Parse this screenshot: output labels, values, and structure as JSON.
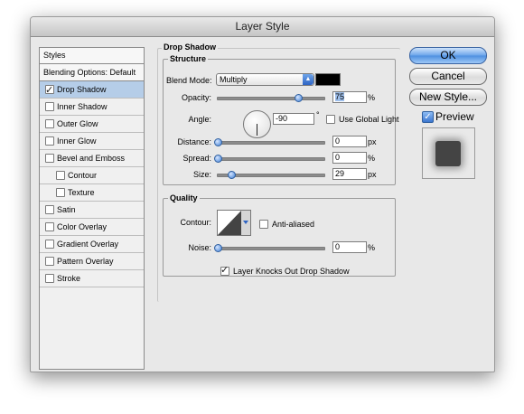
{
  "window": {
    "title": "Layer Style"
  },
  "styles_list": {
    "header": "Styles",
    "blending_options": "Blending Options: Default",
    "items": [
      {
        "label": "Drop Shadow",
        "checked": true,
        "selected": true,
        "indent": false
      },
      {
        "label": "Inner Shadow",
        "checked": false,
        "selected": false,
        "indent": false
      },
      {
        "label": "Outer Glow",
        "checked": false,
        "selected": false,
        "indent": false
      },
      {
        "label": "Inner Glow",
        "checked": false,
        "selected": false,
        "indent": false
      },
      {
        "label": "Bevel and Emboss",
        "checked": false,
        "selected": false,
        "indent": false
      },
      {
        "label": "Contour",
        "checked": false,
        "selected": false,
        "indent": true
      },
      {
        "label": "Texture",
        "checked": false,
        "selected": false,
        "indent": true
      },
      {
        "label": "Satin",
        "checked": false,
        "selected": false,
        "indent": false
      },
      {
        "label": "Color Overlay",
        "checked": false,
        "selected": false,
        "indent": false
      },
      {
        "label": "Gradient Overlay",
        "checked": false,
        "selected": false,
        "indent": false
      },
      {
        "label": "Pattern Overlay",
        "checked": false,
        "selected": false,
        "indent": false
      },
      {
        "label": "Stroke",
        "checked": false,
        "selected": false,
        "indent": false
      }
    ]
  },
  "drop_shadow": {
    "title": "Drop Shadow",
    "structure": {
      "title": "Structure",
      "blend_mode_label": "Blend Mode:",
      "blend_mode_value": "Multiply",
      "shadow_color": "#000000",
      "opacity_label": "Opacity:",
      "opacity_value": "75",
      "opacity_unit": "%",
      "opacity_level": 0.75,
      "angle_label": "Angle:",
      "angle_value": "-90",
      "angle_unit": "°",
      "use_global_light_label": "Use Global Light",
      "use_global_light": false,
      "distance_label": "Distance:",
      "distance_value": "0",
      "distance_unit": "px",
      "spread_label": "Spread:",
      "spread_value": "0",
      "spread_unit": "%",
      "size_label": "Size:",
      "size_value": "29",
      "size_unit": "px"
    },
    "quality": {
      "title": "Quality",
      "contour_label": "Contour:",
      "anti_aliased_label": "Anti-aliased",
      "anti_aliased": false,
      "noise_label": "Noise:",
      "noise_value": "0",
      "noise_unit": "%"
    },
    "knockout_label": "Layer Knocks Out Drop Shadow",
    "knockout_checked": true
  },
  "buttons": {
    "ok": "OK",
    "cancel": "Cancel",
    "new_style": "New Style...",
    "preview_label": "Preview",
    "preview_checked": true
  },
  "colors": {
    "accent": "#4d8fe0",
    "selection": "#b5cde8",
    "dialog_bg": "#e8e8e8"
  }
}
